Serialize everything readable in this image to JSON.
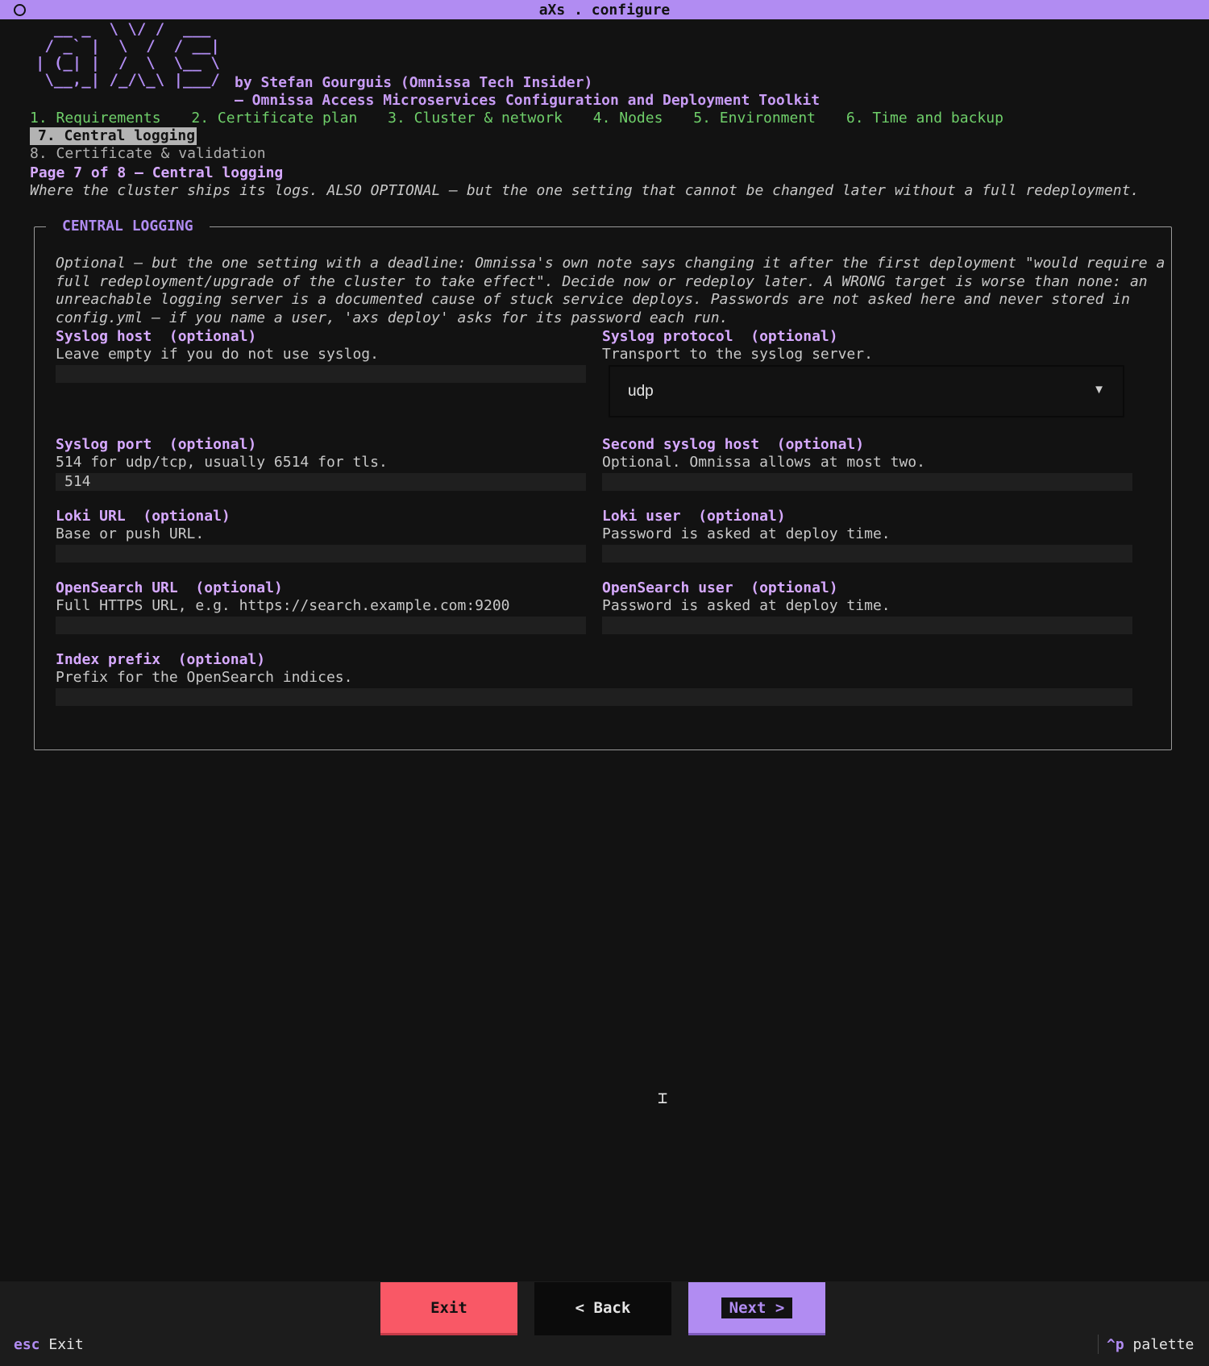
{
  "window": {
    "title": "aXs . configure"
  },
  "header": {
    "logo_text": "  __ _  \\ \\/ /  ___\n / _` |  \\  /  / __|\n| (_| |  /  \\  \\__ \\\n \\__,_| /_/\\_\\ |___/",
    "byline": "by Stefan Gourguis (Omnissa Tech Insider)",
    "subtitle": "– Omnissa Access Microservices Configuration and Deployment Toolkit"
  },
  "steps": [
    {
      "label": "1. Requirements"
    },
    {
      "label": "2. Certificate plan"
    },
    {
      "label": "3. Cluster & network"
    },
    {
      "label": "4. Nodes"
    },
    {
      "label": "5. Environment"
    },
    {
      "label": "6. Time and backup"
    },
    {
      "label": "7. Central logging"
    },
    {
      "label": "8. Certificate & validation"
    }
  ],
  "page": {
    "heading": "Page 7 of 8 – Central logging",
    "description": "Where the cluster ships its logs. ALSO OPTIONAL – but the one setting that cannot be changed later without a full redeployment."
  },
  "panel": {
    "title": "CENTRAL LOGGING",
    "intro": "Optional – but the one setting with a deadline: Omnissa's own note says changing it after the first deployment \"would require a full redeployment/upgrade of the cluster to take effect\". Decide now or redeploy later. A WRONG target is worse than none: an unreachable logging server is a documented cause of stuck service deploys. Passwords are not asked here and never stored in config.yml – if you name a user, 'axs deploy' asks for its password each run."
  },
  "fields": {
    "syslog_host": {
      "label": "Syslog host  (optional)",
      "help": "Leave empty if you do not use syslog.",
      "value": ""
    },
    "syslog_protocol": {
      "label": "Syslog protocol  (optional)",
      "help": "Transport to the syslog server.",
      "value": "udp"
    },
    "syslog_port": {
      "label": "Syslog port  (optional)",
      "help": "514 for udp/tcp, usually 6514 for tls.",
      "value": "514"
    },
    "second_syslog_host": {
      "label": "Second syslog host  (optional)",
      "help": "Optional. Omnissa allows at most two.",
      "value": ""
    },
    "loki_url": {
      "label": "Loki URL  (optional)",
      "help": "Base or push URL.",
      "value": ""
    },
    "loki_user": {
      "label": "Loki user  (optional)",
      "help": "Password is asked at deploy time.",
      "value": ""
    },
    "opensearch_url": {
      "label": "OpenSearch URL  (optional)",
      "help": "Full HTTPS URL, e.g. https://search.example.com:9200",
      "value": ""
    },
    "opensearch_user": {
      "label": "OpenSearch user  (optional)",
      "help": "Password is asked at deploy time.",
      "value": ""
    },
    "index_prefix": {
      "label": "Index prefix  (optional)",
      "help": "Prefix for the OpenSearch indices.",
      "value": ""
    }
  },
  "buttons": {
    "exit": "Exit",
    "back": "< Back",
    "next": "Next >"
  },
  "footer": {
    "esc_key": "esc",
    "esc_label": "Exit",
    "palette_key": "^p",
    "palette_label": "palette"
  },
  "colors": {
    "accent": "#b18cf2",
    "green": "#6fcf6a",
    "danger": "#f95866",
    "background": "#121212"
  }
}
